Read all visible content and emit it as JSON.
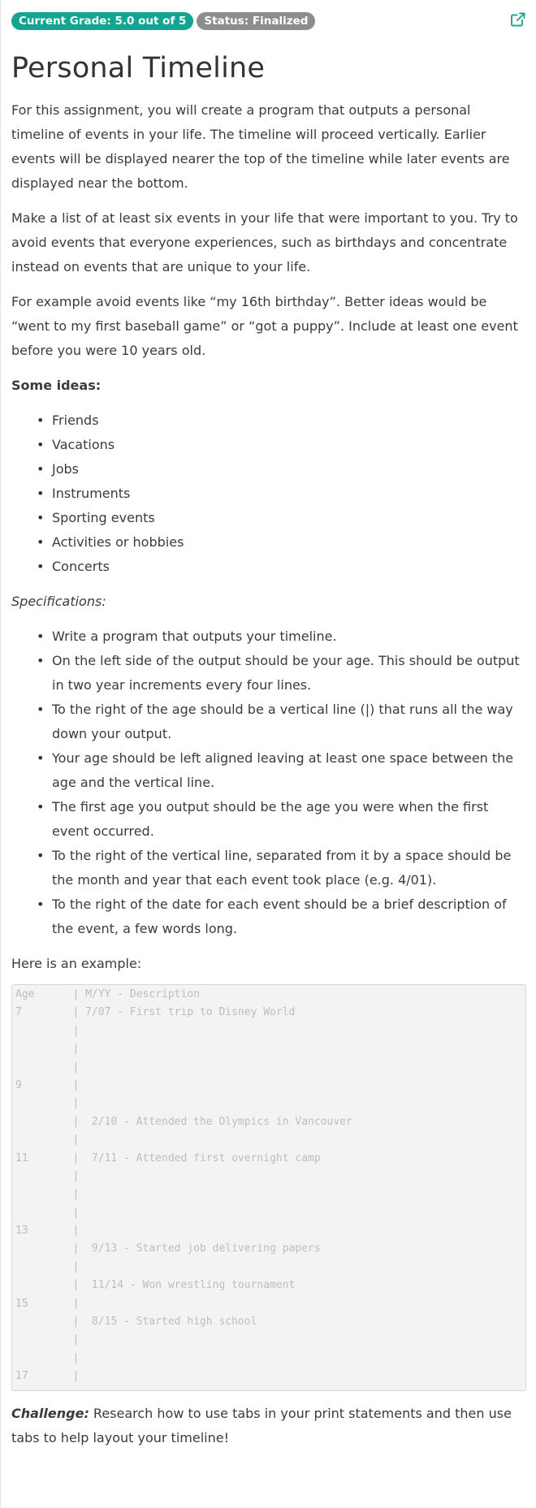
{
  "header": {
    "grade_badge": "Current Grade: 5.0 out of 5",
    "status_badge": "Status: Finalized",
    "open_external_icon": "external-link-icon"
  },
  "title": "Personal Timeline",
  "intro_paragraphs": [
    "For this assignment, you will create a program that outputs a personal timeline of events in your life. The timeline will proceed vertically. Earlier events will be displayed nearer the top of the timeline while later events are displayed near the bottom.",
    "Make a list of at least six events in your life that were important to you. Try to avoid events that everyone experiences, such as birthdays and concentrate instead on events that are unique to your life.",
    "For example avoid events like “my 16th birthday”. Better ideas would be “went to my first baseball game” or “got a puppy”. Include at least one event before you were 10 years old."
  ],
  "ideas_heading": "Some ideas:",
  "ideas": [
    "Friends",
    "Vacations",
    "Jobs",
    "Instruments",
    "Sporting events",
    "Activities or hobbies",
    "Concerts"
  ],
  "specs_heading": "Specifications:",
  "specs": [
    "Write a program that outputs your timeline.",
    "On the left side of the output should be your age. This should be output in two year increments every four lines.",
    "To the right of the age should be a vertical line (|) that runs all the way down your output.",
    "Your age should be left aligned leaving at least one space between the age and the vertical line.",
    "The first age you output should be the age you were when the first event occurred.",
    "To the right of the vertical line, separated from it by a space should be the month and year that each event took place (e.g. 4/01).",
    "To the right of the date for each event should be a brief description of the event, a few words long."
  ],
  "example_intro": "Here is an example:",
  "example_lines": [
    "Age      | M/YY - Description",
    "7        | 7/07 - First trip to Disney World",
    "         |",
    "         |",
    "         |",
    "9        |",
    "         |",
    "         |  2/10 - Attended the Olympics in Vancouver",
    "         |",
    "11       |  7/11 - Attended first overnight camp",
    "         |",
    "         |",
    "         |",
    "13       |",
    "         |  9/13 - Started job delivering papers",
    "         |",
    "         |  11/14 - Won wrestling tournament",
    "15       |",
    "         |  8/15 - Started high school",
    "         |",
    "         |",
    "17       |"
  ],
  "challenge": {
    "label": "Challenge:",
    "text": " Research how to use tabs in your print statements and then use tabs to help layout your timeline!"
  }
}
